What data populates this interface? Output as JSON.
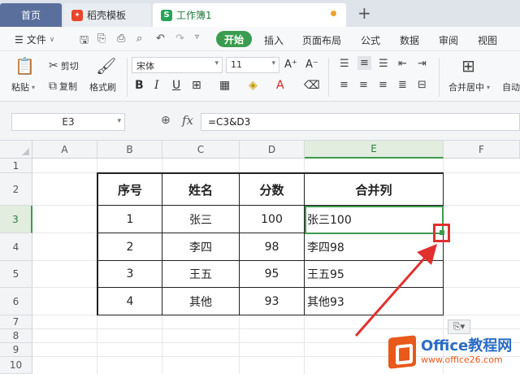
{
  "tabs": {
    "home": "首页",
    "template": "稻壳模板",
    "workbook": "工作簿1",
    "new_tab": "+"
  },
  "menu": {
    "file": "文件",
    "start": "开始",
    "items": [
      "插入",
      "页面布局",
      "公式",
      "数据",
      "审阅",
      "视图"
    ]
  },
  "ribbon": {
    "paste": "粘贴",
    "cut": "剪切",
    "copy": "复制",
    "format_painter": "格式刷",
    "font_name": "宋体",
    "font_size": "11",
    "bold": "B",
    "italic": "I",
    "underline": "U",
    "merge_center": "合并居中",
    "auto_wrap": "自动"
  },
  "formula_bar": {
    "name_box": "E3",
    "fx": "fx",
    "formula": "=C3&D3"
  },
  "columns": [
    "A",
    "B",
    "C",
    "D",
    "E",
    "F"
  ],
  "rows": [
    "1",
    "2",
    "3",
    "4",
    "5",
    "6",
    "7",
    "8",
    "9",
    "10"
  ],
  "selected_cell": "E3",
  "table": {
    "headers": [
      "序号",
      "姓名",
      "分数",
      "合并列"
    ],
    "rows": [
      [
        "1",
        "张三",
        "100",
        "张三100"
      ],
      [
        "2",
        "李四",
        "98",
        "李四98"
      ],
      [
        "3",
        "王五",
        "95",
        "王五95"
      ],
      [
        "4",
        "其他",
        "93",
        "其他93"
      ]
    ]
  },
  "watermark": {
    "title_en": "Office",
    "title_cn": "教程网",
    "url": "www.office26.com"
  },
  "colors": {
    "accent_green": "#3f9a4e",
    "highlight_red": "#e03030",
    "home_tab": "#5a6f9c"
  }
}
